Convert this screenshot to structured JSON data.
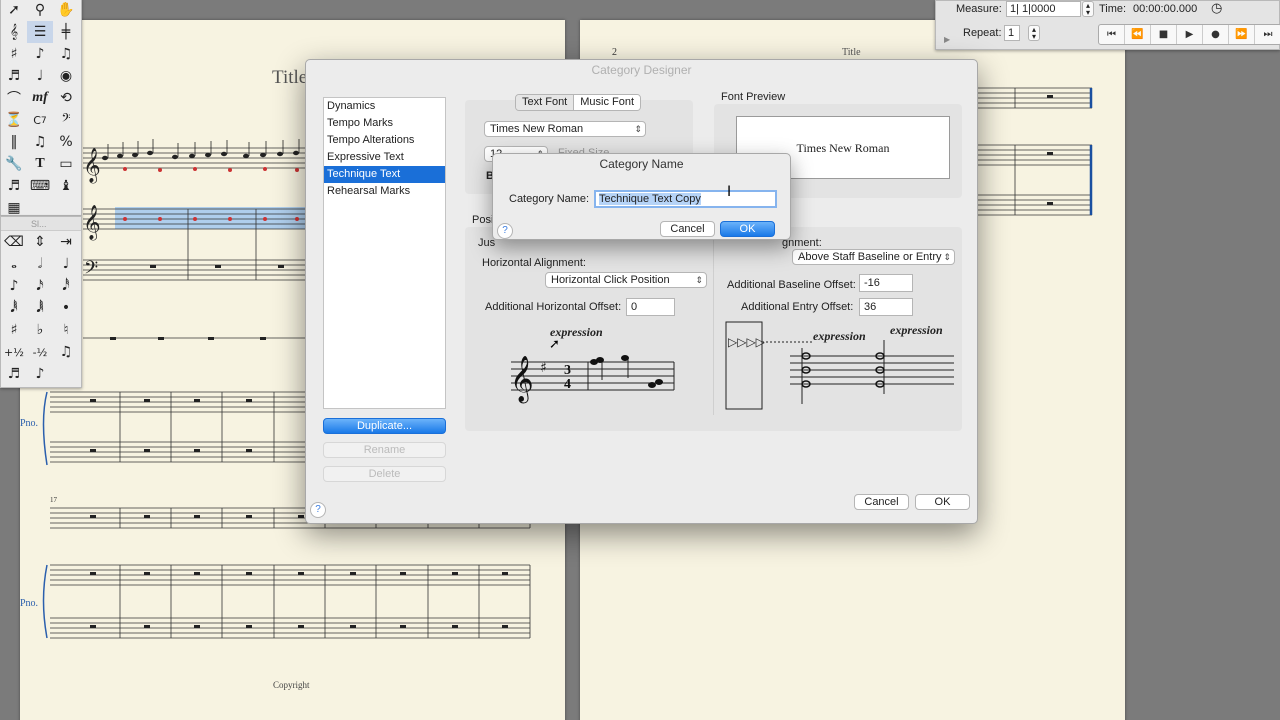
{
  "score": {
    "page1": {
      "title": "Title",
      "instrument_label_1": "Pno.",
      "instrument_label_2": "Pno.",
      "measure_number": "17",
      "copyright": "Copyright"
    },
    "page2": {
      "page_number": "2",
      "title": "Title"
    }
  },
  "playback": {
    "measure_label": "Measure:",
    "measure_value": "1| 1|0000",
    "time_label": "Time:",
    "time_value": "00:00:00.000",
    "repeat_label": "Repeat:",
    "repeat_value": "1"
  },
  "palette_secondary_title": "Sl...",
  "category_designer": {
    "title": "Category Designer",
    "categories": [
      "Dynamics",
      "Tempo Marks",
      "Tempo Alterations",
      "Expressive Text",
      "Technique Text",
      "Rehearsal Marks"
    ],
    "selected_category": "Technique Text",
    "buttons": {
      "duplicate": "Duplicate...",
      "rename": "Rename",
      "delete": "Delete",
      "cancel": "Cancel",
      "ok": "OK",
      "help": "?"
    },
    "font_tabs": [
      "Text Font",
      "Music Font"
    ],
    "font_name": "Times New Roman",
    "font_size": "12",
    "fixed_size_label": "Fixed Size",
    "font_preview_label": "Font Preview",
    "font_preview_text": "Times New Roman",
    "positioning_label": "Posi",
    "justification_label": "Jus",
    "horizontal_alignment_label": "Horizontal Alignment:",
    "horizontal_alignment_value": "Horizontal Click Position",
    "additional_horizontal_offset_label": "Additional Horizontal Offset:",
    "additional_horizontal_offset_value": "0",
    "vertical_alignment_label": "gnment:",
    "vertical_alignment_value": "Above Staff Baseline or Entry",
    "additional_baseline_offset_label": "Additional Baseline Offset:",
    "additional_baseline_offset_value": "-16",
    "additional_entry_offset_label": "Additional Entry Offset:",
    "additional_entry_offset_value": "36",
    "example_text": "expression"
  },
  "category_name_sheet": {
    "title": "Category Name",
    "label": "Category Name:",
    "value": "Technique Text Copy",
    "cancel": "Cancel",
    "ok": "OK",
    "help": "?"
  }
}
